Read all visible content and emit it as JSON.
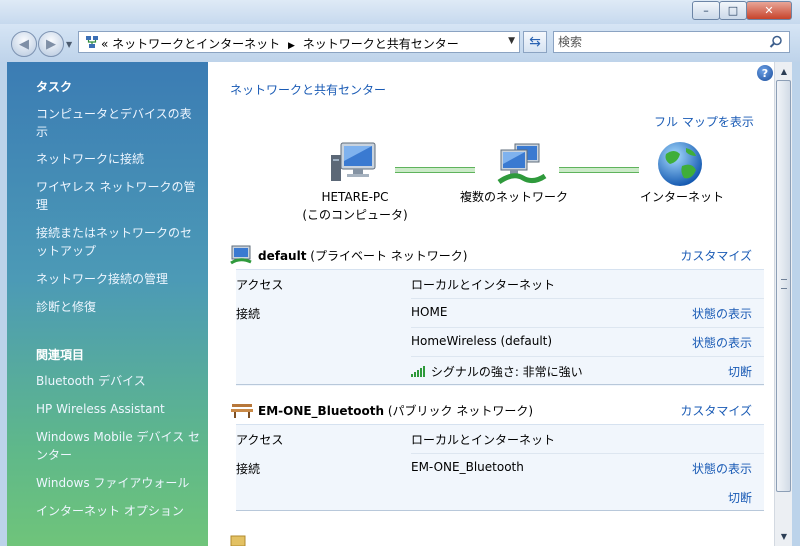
{
  "address": {
    "crumb1": "« ネットワークとインターネット",
    "crumb2": "ネットワークと共有センター"
  },
  "search": {
    "placeholder": "検索"
  },
  "sidebar": {
    "tasks_heading": "タスク",
    "tasks": [
      "コンピュータとデバイスの表示",
      "ネットワークに接続",
      "ワイヤレス ネットワークの管理",
      "接続またはネットワークのセットアップ",
      "ネットワーク接続の管理",
      "診断と修復"
    ],
    "related_heading": "関連項目",
    "related": [
      "Bluetooth デバイス",
      "HP Wireless Assistant",
      "Windows Mobile デバイス センター",
      "Windows ファイアウォール",
      "インターネット オプション"
    ]
  },
  "main": {
    "title": "ネットワークと共有センター",
    "full_map": "フル マップを表示",
    "map": {
      "pc_name": "HETARE-PC",
      "pc_sub": "(このコンピュータ)",
      "multi": "複数のネットワーク",
      "internet": "インターネット"
    },
    "networks": [
      {
        "name": "default",
        "type": "(プライベート ネットワーク)",
        "customize": "カスタマイズ",
        "access_label": "アクセス",
        "access_value": "ローカルとインターネット",
        "conn_label": "接続",
        "conns": [
          {
            "value": "HOME",
            "action": "状態の表示"
          },
          {
            "value": "HomeWireless (default)",
            "action": "状態の表示"
          },
          {
            "value": "シグナルの強さ: 非常に強い",
            "action": "切断"
          }
        ]
      },
      {
        "name": "EM-ONE_Bluetooth",
        "type": "(パブリック ネットワーク)",
        "customize": "カスタマイズ",
        "access_label": "アクセス",
        "access_value": "ローカルとインターネット",
        "conn_label": "接続",
        "conns": [
          {
            "value": "EM-ONE_Bluetooth",
            "action": "状態の表示"
          },
          {
            "value": "",
            "action": "切断"
          }
        ]
      }
    ]
  },
  "colors": {
    "link": "#1a5bb5",
    "sidebar_top": "#3b7cb4",
    "sidebar_bottom": "#6fc47a"
  }
}
